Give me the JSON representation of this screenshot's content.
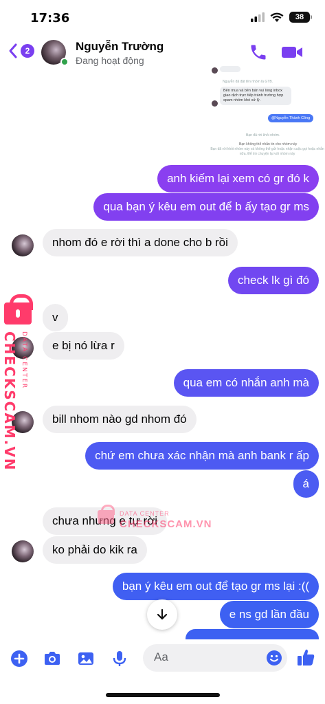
{
  "status_bar": {
    "time": "17:36",
    "battery": "38"
  },
  "header": {
    "back_badge": "2",
    "contact_name": "Nguyễn Trường",
    "contact_status": "Đang hoạt động"
  },
  "embedded_screenshot": {
    "top_line": "Nguyễn đã đặt tên nhóm là GTB.",
    "bubble": "Bên mua và bên bán vui  lòng inbox giao dịch trực tiếp tránh trường hợp spam nhóm khó xử lý.",
    "mention": "@Nguyễn Thành Công",
    "left_group": "Bạn đã rời khỏi nhóm.",
    "cannot_receive": "Bạn không thể nhắn tin cho nhóm này",
    "cannot_receive_sub": "Bạn đã rời khỏi nhóm này và không thể gửi hoặc nhận cuộc gọi hoặc nhắn nữa. Để trò chuyện lại với nhóm này"
  },
  "messages": [
    {
      "dir": "out",
      "text": "anh kiếm lại xem có gr đó k"
    },
    {
      "dir": "out",
      "text": "qua bạn ý kêu em out để b ấy tạo gr ms"
    },
    {
      "dir": "in",
      "text": "nhom đó e rời thì a done cho b rồi"
    },
    {
      "dir": "out",
      "text": "check lk gì đó"
    },
    {
      "dir": "in",
      "text": "v"
    },
    {
      "dir": "in",
      "text": "e bị nó lừa r"
    },
    {
      "dir": "out",
      "text": "qua em có nhắn anh mà"
    },
    {
      "dir": "in",
      "text": "bill nhom nào gd nhom đó"
    },
    {
      "dir": "out",
      "text": "chứ em chưa xác nhận mà anh bank r ấp"
    },
    {
      "dir": "out",
      "text": "á"
    },
    {
      "dir": "in",
      "text": "chưa nhưng e tự rời"
    },
    {
      "dir": "in",
      "text": "ko phải do kik ra"
    },
    {
      "dir": "out",
      "text": "bạn ý kêu em out để tạo gr ms lại :(("
    },
    {
      "dir": "out",
      "text": "e ns gd lần đầu"
    }
  ],
  "watermark": {
    "brand": "CHECKSCAM.VN",
    "tag": "DATA CENTER",
    "center_brand": "CHECKSCAM.VN",
    "center_tag": "DATA CENTER"
  },
  "composer": {
    "placeholder": "Aa"
  },
  "icons": [
    "back-chevron-icon",
    "phone-icon",
    "video-camera-icon",
    "plus-icon",
    "camera-icon",
    "image-icon",
    "microphone-icon",
    "emoji-icon",
    "like-icon",
    "arrow-down-icon"
  ],
  "colors": {
    "accent": "#7a3ff0",
    "bubble_top": "#8a3ff0",
    "bubble_bottom": "#3d61f2",
    "incoming": "#efeef0"
  }
}
